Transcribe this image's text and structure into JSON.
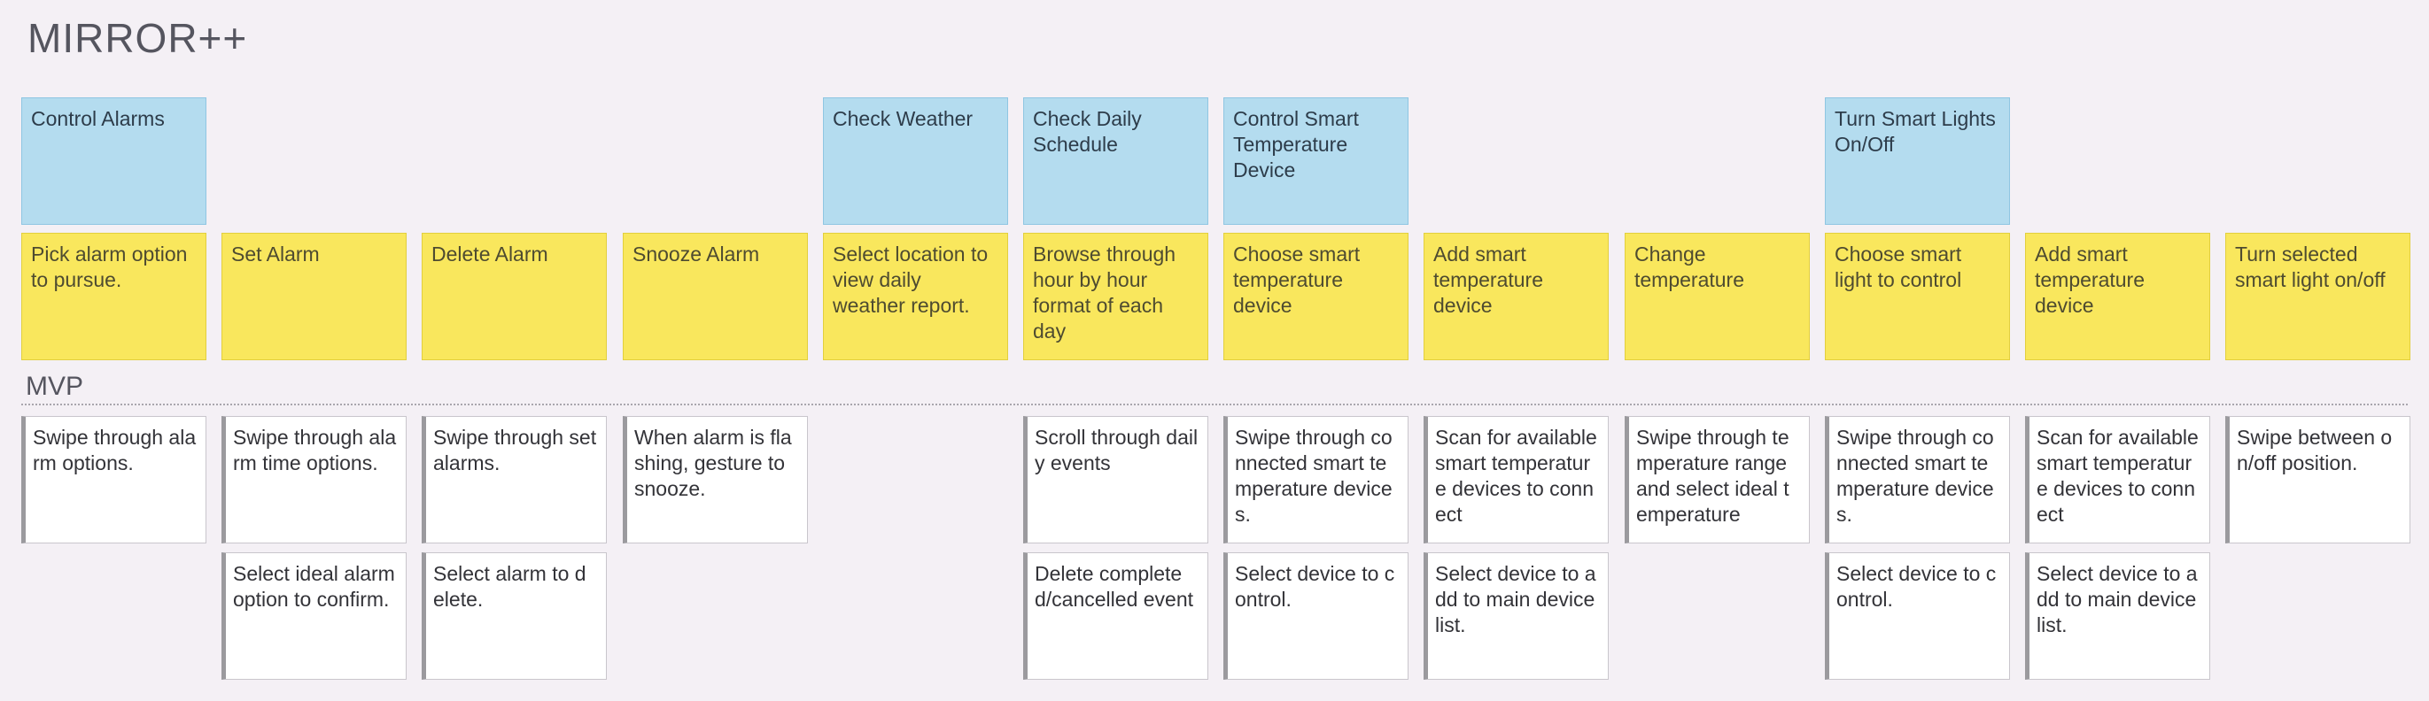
{
  "title": "MIRROR++",
  "activities": [
    {
      "col": 0,
      "text": "Control Alarms"
    },
    {
      "col": 4,
      "text": "Check Weather"
    },
    {
      "col": 5,
      "text": "Check Daily Schedule"
    },
    {
      "col": 6,
      "text": "Control Smart Temperature Device"
    },
    {
      "col": 9,
      "text": "Turn Smart Lights On/Off"
    }
  ],
  "tasks": [
    "Pick alarm option to pursue.",
    "Set Alarm",
    "Delete Alarm",
    "Snooze Alarm",
    "Select location to view daily weather report.",
    "Browse through hour by hour format of each day",
    "Choose smart temperature device",
    "Add smart temperature device",
    "Change temperature",
    "Choose smart light to control",
    "Add smart temperature device",
    "Turn selected smart light on/off"
  ],
  "release_label": "MVP",
  "stories": [
    {
      "col": 0,
      "row": 0,
      "text": "Swipe through alarm options."
    },
    {
      "col": 1,
      "row": 0,
      "text": "Swipe through alarm time options."
    },
    {
      "col": 1,
      "row": 1,
      "text": "Select ideal alarm option to confirm."
    },
    {
      "col": 2,
      "row": 0,
      "text": "Swipe through set alarms."
    },
    {
      "col": 2,
      "row": 1,
      "text": "Select alarm to delete."
    },
    {
      "col": 3,
      "row": 0,
      "text": "When alarm is flashing, gesture to snooze."
    },
    {
      "col": 5,
      "row": 0,
      "text": "Scroll through daily events"
    },
    {
      "col": 5,
      "row": 1,
      "text": "Delete completed/cancelled event"
    },
    {
      "col": 6,
      "row": 0,
      "text": "Swipe through connected smart temperature devices."
    },
    {
      "col": 6,
      "row": 1,
      "text": "Select device to control."
    },
    {
      "col": 7,
      "row": 0,
      "text": "Scan for available smart temperature devices to connect"
    },
    {
      "col": 7,
      "row": 1,
      "text": "Select device to add to main device list."
    },
    {
      "col": 8,
      "row": 0,
      "text": "Swipe through temperature range and select ideal temperature"
    },
    {
      "col": 9,
      "row": 0,
      "text": "Swipe through connected smart temperature devices."
    },
    {
      "col": 9,
      "row": 1,
      "text": "Select device to control."
    },
    {
      "col": 10,
      "row": 0,
      "text": "Scan for available smart temperature devices to connect"
    },
    {
      "col": 10,
      "row": 1,
      "text": "Select device to add to main device list."
    },
    {
      "col": 11,
      "row": 0,
      "text": "Swipe between on/off position."
    }
  ],
  "colors": {
    "background": "#f4f0f5",
    "activity": "#b4dcef",
    "task": "#f9e75d",
    "story": "#ffffff"
  }
}
